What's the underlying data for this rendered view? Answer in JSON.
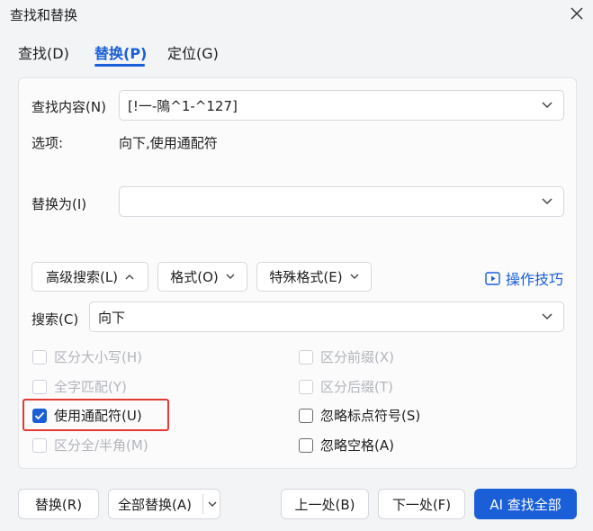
{
  "window": {
    "title": "查找和替换"
  },
  "tabs": [
    {
      "label": "查找(D)"
    },
    {
      "label": "替换(P)"
    },
    {
      "label": "定位(G)"
    }
  ],
  "find": {
    "label": "查找内容(N)",
    "value": "[!一-隝^1-^127]"
  },
  "options": {
    "label": "选项:",
    "value": "向下,使用通配符"
  },
  "replace": {
    "label": "替换为(I)",
    "value": ""
  },
  "buttons": {
    "advanced": "高级搜索(L)",
    "format": "格式(O)",
    "special": "特殊格式(E)",
    "tips": "操作技巧"
  },
  "search": {
    "label": "搜索(C)",
    "value": "向下"
  },
  "checkboxes": {
    "match_case": "区分大小写(H)",
    "whole_word": "全字匹配(Y)",
    "wildcards": "使用通配符(U)",
    "full_half": "区分全/半角(M)",
    "prefix": "区分前缀(X)",
    "suffix": "区分后缀(T)",
    "ignore_punct": "忽略标点符号(S)",
    "ignore_space": "忽略空格(A)"
  },
  "actions": {
    "replace": "替换(R)",
    "replace_all": "全部替换(A)",
    "prev": "上一处(B)",
    "next": "下一处(F)",
    "ai_find_all": "AI 查找全部"
  },
  "colors": {
    "accent": "#1a5fd8",
    "highlight": "#e53935"
  }
}
